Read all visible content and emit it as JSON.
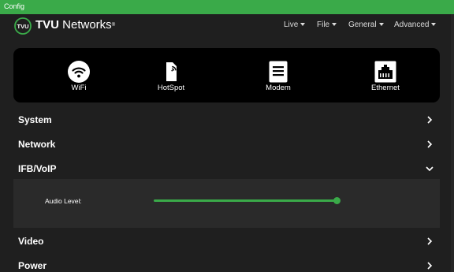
{
  "window": {
    "title": "Config"
  },
  "brand": {
    "name_bold": "TVU",
    "name_rest": " Networks",
    "trademark": "®",
    "badge_text": "TVU"
  },
  "nav": [
    {
      "label": "Live"
    },
    {
      "label": "File"
    },
    {
      "label": "General"
    },
    {
      "label": "Advanced"
    }
  ],
  "connections": [
    {
      "label": "WiFi",
      "icon": "wifi-icon"
    },
    {
      "label": "HotSpot",
      "icon": "hotspot-icon"
    },
    {
      "label": "Modem",
      "icon": "modem-icon"
    },
    {
      "label": "Ethernet",
      "icon": "ethernet-icon"
    }
  ],
  "sections": [
    {
      "label": "System",
      "expanded": false
    },
    {
      "label": "Network",
      "expanded": false
    },
    {
      "label": "IFB/VoIP",
      "expanded": true
    },
    {
      "label": "Video",
      "expanded": false
    },
    {
      "label": "Power",
      "expanded": false
    }
  ],
  "ifb": {
    "audio_level_label": "Audio Level:",
    "audio_level_value": 1.0
  },
  "colors": {
    "accent": "#3aaa49",
    "background": "#1f1f1f",
    "panel": "#000000",
    "expanded_body": "#2a2a2a"
  }
}
